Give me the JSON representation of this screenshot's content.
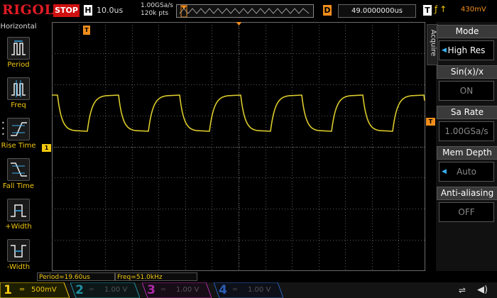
{
  "topbar": {
    "brand": "RIGOL",
    "run_state": "STOP",
    "h_badge": "H",
    "timebase": "10.0us",
    "sample_rate": "1.00GSa/s",
    "memory_depth": "120k pts",
    "d_badge": "D",
    "delay": "49.0000000us",
    "t_badge": "T",
    "trigger_level": "430mV",
    "icons": [
      "trigger-source-icon",
      "trigger-slope-icon"
    ]
  },
  "left_menu": {
    "title": "Horizontal",
    "items": [
      {
        "label": "Period",
        "icon": "period-icon"
      },
      {
        "label": "Freq",
        "icon": "freq-icon"
      },
      {
        "label": "Rise Time",
        "icon": "rise-time-icon"
      },
      {
        "label": "Fall Time",
        "icon": "fall-time-icon"
      },
      {
        "label": "+Width",
        "icon": "pos-width-icon"
      },
      {
        "label": "-Width",
        "icon": "neg-width-icon"
      }
    ]
  },
  "markers": {
    "ch1_ground": "1",
    "trig_pos": "T",
    "trig_level": "T"
  },
  "right_panel": {
    "tab": "Acquire",
    "items": [
      {
        "title": "Mode",
        "value": "High Res",
        "active": true,
        "arrow": true
      },
      {
        "title": "Sin(x)/x",
        "value": "ON",
        "active": false,
        "arrow": false
      },
      {
        "title": "Sa Rate",
        "value": "1.00GSa/s",
        "active": false,
        "arrow": false
      },
      {
        "title": "Mem Depth",
        "value": "Auto",
        "active": false,
        "arrow": true
      },
      {
        "title": "Anti-aliasing",
        "value": "OFF",
        "active": false,
        "arrow": false
      }
    ]
  },
  "measurements": {
    "period": "Period=19.60us",
    "freq": "Freq=51.0kHz"
  },
  "channels": [
    {
      "num": "1",
      "scale": "500mV",
      "color": "#f2c80f"
    },
    {
      "num": "2",
      "scale": "1.00 V",
      "color": "#1f8fa0"
    },
    {
      "num": "3",
      "scale": "1.00 V",
      "color": "#b02aa8"
    },
    {
      "num": "4",
      "scale": "1.00 V",
      "color": "#2a5fb8"
    }
  ],
  "colors": {
    "trace": "#d6c41a",
    "accent": "#f2c80f",
    "trigger": "#f28e1c",
    "stop": "#d01010"
  }
}
